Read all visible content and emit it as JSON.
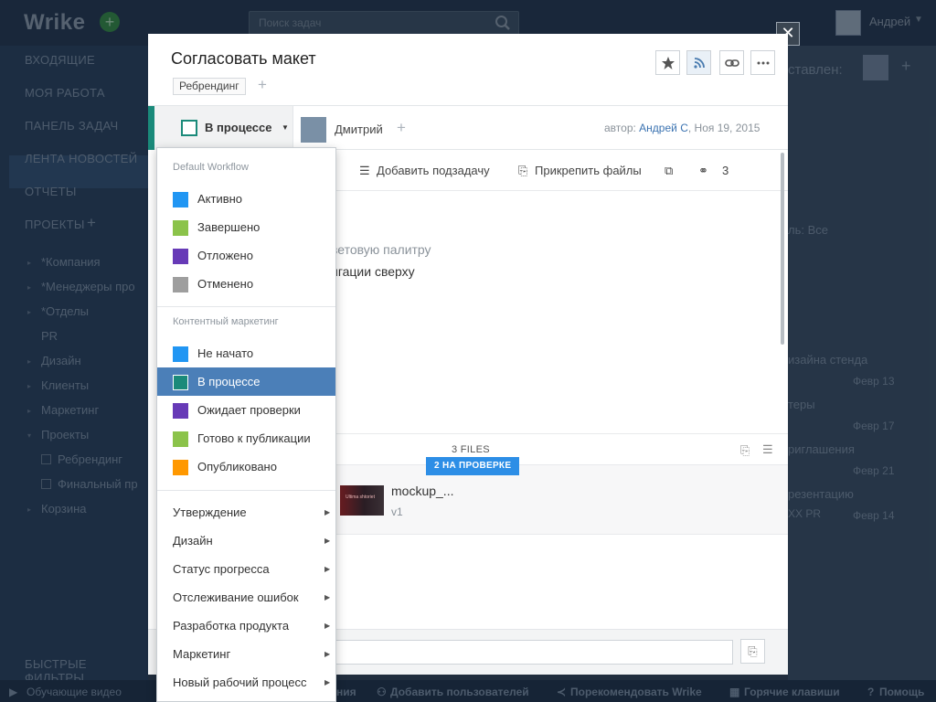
{
  "app": {
    "logo": "Wrike",
    "search_placeholder": "Поиск задач",
    "user_name": "Андрей"
  },
  "sidebar": {
    "items": [
      {
        "label": "ВХОДЯЩИЕ"
      },
      {
        "label": "МОЯ РАБОТА"
      },
      {
        "label": "ПАНЕЛЬ ЗАДАЧ"
      },
      {
        "label": "ЛЕНТА НОВОСТЕЙ"
      },
      {
        "label": "ОТЧЕТЫ"
      },
      {
        "label": "ПРОЕКТЫ"
      }
    ],
    "projects_plus": "+",
    "projects": [
      {
        "label": "*Компания"
      },
      {
        "label": "*Менеджеры про"
      },
      {
        "label": "*Отделы"
      },
      {
        "label": "PR"
      },
      {
        "label": "Дизайн"
      },
      {
        "label": "Клиенты"
      },
      {
        "label": "Маркетинг"
      },
      {
        "label": "Проекты"
      },
      {
        "label": "Ребрендинг"
      },
      {
        "label": "Финальный пр"
      },
      {
        "label": "Корзина"
      }
    ],
    "quick_filters": "БЫСТРЫЕ ФИЛЬТРЫ"
  },
  "bottom_bar": {
    "videos": "Обучающие видео",
    "partial": "ния",
    "add_users": "Добавить пользователей",
    "recommend": "Порекомендовать Wrike",
    "hotkeys": "Горячие клавиши",
    "help": "Помощь"
  },
  "background_panel": {
    "header": "ставлен:",
    "filter": "ль: Все",
    "rows": [
      {
        "title": "изайна стенда",
        "date": "Февр 13"
      },
      {
        "title": "теры",
        "date": "Февр 17"
      },
      {
        "title": "риглашения",
        "date": "Февр 21"
      },
      {
        "title": "резентацию",
        "date": "Февр 14",
        "sub": "XX PR"
      }
    ]
  },
  "task": {
    "title": "Согласовать макет",
    "tag": "Ребрендинг",
    "tag_add": "+",
    "status": "В процессе",
    "assignee": "Дмитрий",
    "assignee_add": "+",
    "meta_prefix": "автор:",
    "author": "Андрей С",
    "date": ", Ноя 19, 2015",
    "add_subtask": "Добавить подзадачу",
    "attach_files": "Прикрепить файлы",
    "share_count": "3",
    "description_line1": "ветовую палитру",
    "description_line2": "игации сверху",
    "files_label": "3 FILES",
    "files_badge": "2 НА ПРОВЕРКЕ",
    "file_name": "mockup_...",
    "file_version": "v1",
    "file_thumb_text": "Ultima shtoriet"
  },
  "status_menu": {
    "groups": [
      {
        "header": "Default Workflow",
        "items": [
          {
            "label": "Активно",
            "color": "#2196f3",
            "selected": false
          },
          {
            "label": "Завершено",
            "color": "#8bc34a",
            "selected": false
          },
          {
            "label": "Отложено",
            "color": "#673ab7",
            "selected": false
          },
          {
            "label": "Отменено",
            "color": "#9e9e9e",
            "selected": false
          }
        ]
      },
      {
        "header": "Контентный маркетинг",
        "items": [
          {
            "label": "Не начато",
            "color": "#2196f3",
            "selected": false
          },
          {
            "label": "В процессе",
            "color": "#1a8a7a",
            "selected": true
          },
          {
            "label": "Ожидает проверки",
            "color": "#673ab7",
            "selected": false
          },
          {
            "label": "Готово к публикации",
            "color": "#8bc34a",
            "selected": false
          },
          {
            "label": "Опубликовано",
            "color": "#ff9800",
            "selected": false
          }
        ]
      }
    ],
    "submenus": [
      {
        "label": "Утверждение"
      },
      {
        "label": "Дизайн"
      },
      {
        "label": "Статус прогресса"
      },
      {
        "label": "Отслеживание ошибок"
      },
      {
        "label": "Разработка продукта"
      },
      {
        "label": "Маркетинг"
      },
      {
        "label": "Новый рабочий процесс"
      }
    ]
  }
}
